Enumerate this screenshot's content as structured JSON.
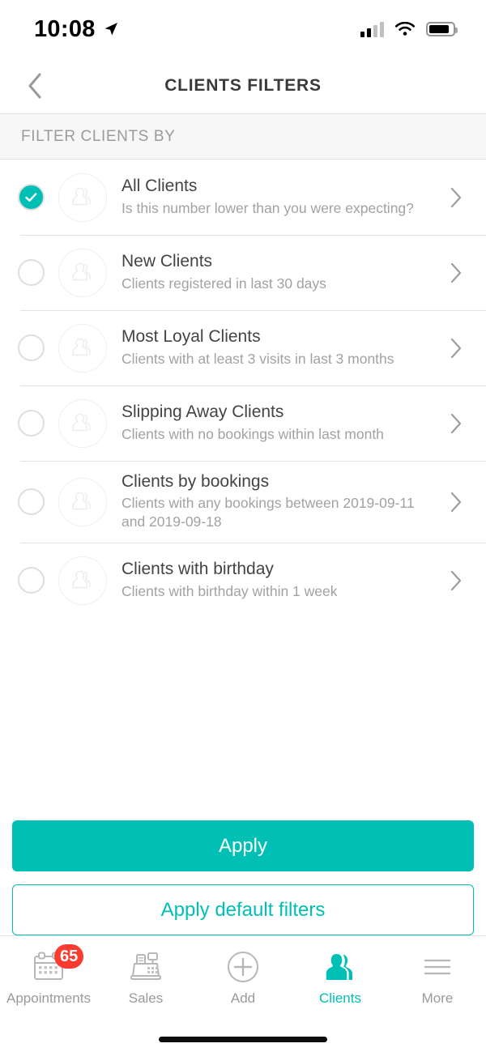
{
  "status_bar": {
    "time": "10:08",
    "location_icon": "location-arrow-icon",
    "signal_icon": "cellular-signal-icon",
    "signal_bars_filled": 2,
    "signal_bars_total": 4,
    "wifi_icon": "wifi-icon",
    "battery_icon": "battery-icon"
  },
  "header": {
    "back_icon": "chevron-left-icon",
    "title": "CLIENTS FILTERS"
  },
  "section": {
    "label": "FILTER CLIENTS BY"
  },
  "filters": [
    {
      "title": "All Clients",
      "subtitle": "Is this number lower than you were expecting?",
      "selected": true
    },
    {
      "title": "New Clients",
      "subtitle": "Clients registered in last 30 days",
      "selected": false
    },
    {
      "title": "Most Loyal Clients",
      "subtitle": "Clients with at least 3 visits in last 3 months",
      "selected": false
    },
    {
      "title": "Slipping Away Clients",
      "subtitle": "Clients with no bookings within last month",
      "selected": false
    },
    {
      "title": "Clients by bookings",
      "subtitle": "Clients with any bookings between 2019-09-11 and 2019-09-18",
      "selected": false
    },
    {
      "title": "Clients with birthday",
      "subtitle": "Clients with birthday within 1 week",
      "selected": false
    }
  ],
  "actions": {
    "apply_label": "Apply",
    "apply_default_label": "Apply default filters"
  },
  "tabbar": {
    "items": [
      {
        "label": "Appointments",
        "icon": "calendar-icon",
        "badge": "65",
        "active": false
      },
      {
        "label": "Sales",
        "icon": "cash-register-icon",
        "badge": null,
        "active": false
      },
      {
        "label": "Add",
        "icon": "plus-circle-icon",
        "badge": null,
        "active": false
      },
      {
        "label": "Clients",
        "icon": "people-icon",
        "badge": null,
        "active": true
      },
      {
        "label": "More",
        "icon": "hamburger-menu-icon",
        "badge": null,
        "active": false
      }
    ]
  },
  "colors": {
    "accent_teal": "#00bfb5",
    "badge_red": "#fb3b30",
    "title_text": "#444444",
    "subtitle_text": "#a2a2a2",
    "section_bg": "#f7f7f7"
  }
}
